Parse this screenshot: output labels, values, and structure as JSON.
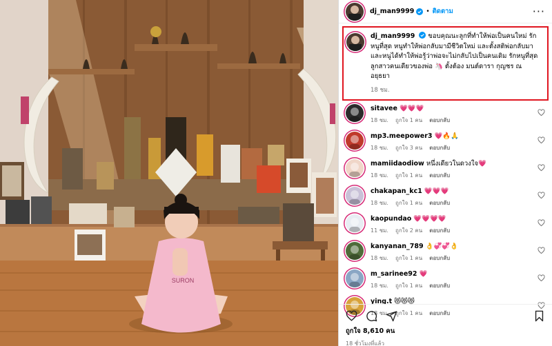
{
  "post": {
    "username": "dj_man9999",
    "follow_label": "ติดตาม",
    "more_icon": "more-horizontal-icon"
  },
  "caption": {
    "username": "dj_man9999",
    "text": "ขอบคุณนะลูกที่ทำให้พ่อเป็นคนใหม่ รักหนูที่สุด หนูทำให้พ่อกลับมามีชีวิตใหม่ และตั้งสติพ่อกลับมา และหนูได้ทำให้พ่อรู้ว่าพ่อจะไม่กลับไปเป็นคนเดิม รักหนูที่สุดลูกสาวคนเดียวของพ่อ 🦄 ตั้งต้อง มนต์ดารา กุญชร ณ อยุธยา",
    "time": "18 ชม."
  },
  "comments": [
    {
      "username": "sitavee",
      "text": "💗💗💗",
      "time": "18 ชม.",
      "likes": "ถูกใจ 1 คน",
      "reply": "ตอบกลับ",
      "avatar_color": "#2b2b2b"
    },
    {
      "username": "mp3.meepower3",
      "text": "💗🔥🙏",
      "time": "18 ชม.",
      "likes": "ถูกใจ 3 คน",
      "reply": "ตอบกลับ",
      "avatar_color": "#c0392b"
    },
    {
      "username": "mamiidaodiow",
      "text": "หนึ่งเดียวในดวงใจ💗",
      "time": "18 ชม.",
      "likes": "ถูกใจ 1 คน",
      "reply": "ตอบกลับ",
      "avatar_color": "#f0d6c8"
    },
    {
      "username": "chakapan_kc1",
      "text": "💗💗💗",
      "time": "18 ชม.",
      "likes": "ถูกใจ 1 คน",
      "reply": "ตอบกลับ",
      "avatar_color": "#c9c1d8"
    },
    {
      "username": "kaopundao",
      "text": "💗💗💗💗",
      "time": "11 ชม.",
      "likes": "ถูกใจ 2 คน",
      "reply": "ตอบกลับ",
      "avatar_color": "#e8edf3"
    },
    {
      "username": "kanyanan_789",
      "text": "👌💞💞👌",
      "time": "18 ชม.",
      "likes": "ถูกใจ 1 คน",
      "reply": "ตอบกลับ",
      "avatar_color": "#4f6b3a"
    },
    {
      "username": "m_sarinee92",
      "text": "💗",
      "time": "18 ชม.",
      "likes": "ถูกใจ 1 คน",
      "reply": "ตอบกลับ",
      "avatar_color": "#8aa6c4"
    },
    {
      "username": "ying.t",
      "text": "😻😻😻",
      "time": "18 ชม.",
      "likes": "ถูกใจ 1 คน",
      "reply": "ตอบกลับ",
      "avatar_color": "#d8a23a"
    }
  ],
  "footer": {
    "like_count": "ถูกใจ 8,610 คน",
    "time_ago": "18 ชั่วโมงที่แล้ว"
  },
  "colors": {
    "accent": "#0095f6",
    "highlight_border": "#e0151f",
    "heart": "#e0245e",
    "secondary_text": "#737373"
  }
}
